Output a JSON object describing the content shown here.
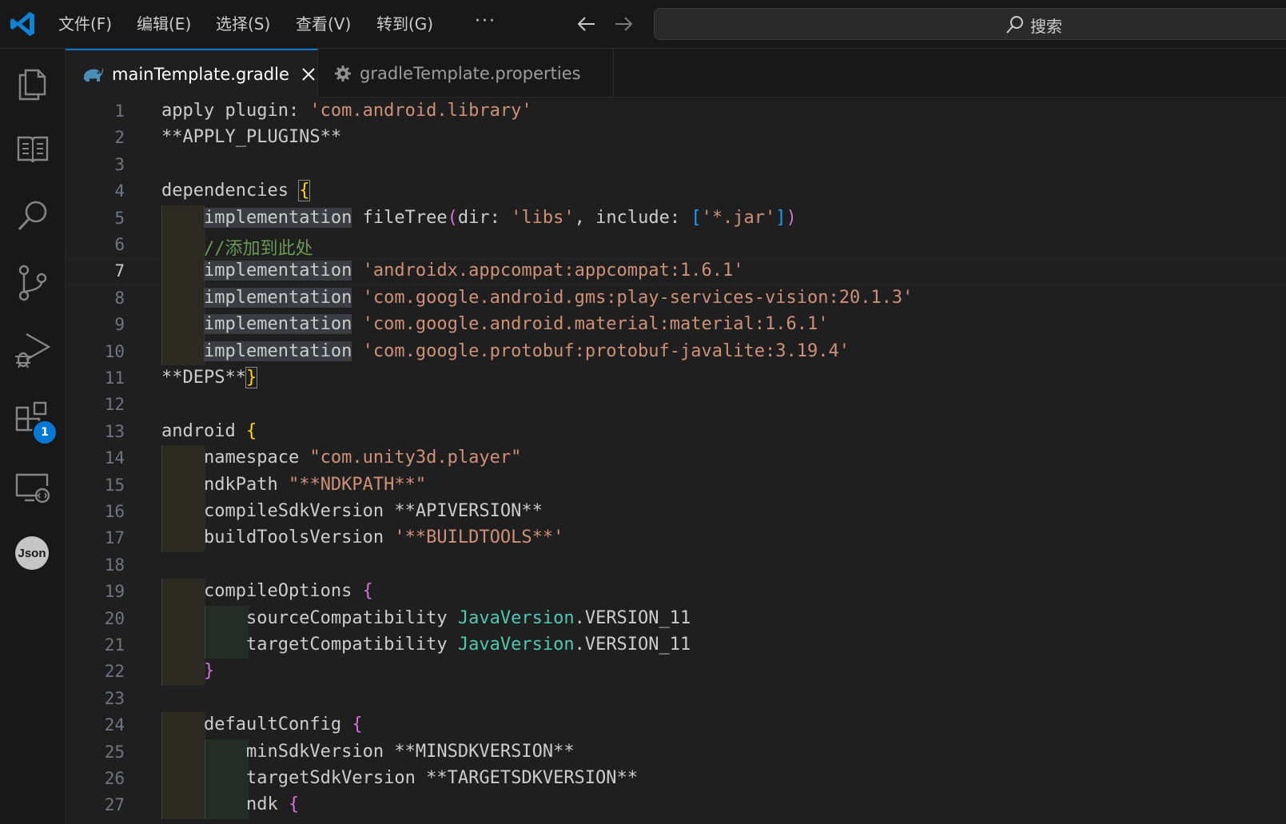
{
  "titlebar": {
    "menu": [
      "文件(F)",
      "编辑(E)",
      "选择(S)",
      "查看(V)",
      "转到(G)"
    ],
    "more": "···",
    "search_placeholder": "搜索"
  },
  "activitybar": {
    "items": [
      "files-icon",
      "book-icon",
      "search-icon",
      "source-control-icon",
      "run-debug-icon",
      "extensions-icon",
      "remote-explorer-icon",
      "json-icon"
    ],
    "extensions_badge": "1",
    "json_label": "Json"
  },
  "tabs": [
    {
      "label": "mainTemplate.gradle",
      "active": true,
      "icon": "gradle-elephant-icon"
    },
    {
      "label": "gradleTemplate.properties",
      "active": false,
      "icon": "gear-icon"
    }
  ],
  "editor": {
    "current_line": 7,
    "lines": [
      {
        "n": "1",
        "text": "apply plugin: 'com.android.library'"
      },
      {
        "n": "2",
        "text": "**APPLY_PLUGINS**"
      },
      {
        "n": "3",
        "text": ""
      },
      {
        "n": "4",
        "text": "dependencies {"
      },
      {
        "n": "5",
        "text": "    implementation fileTree(dir: 'libs', include: ['*.jar'])"
      },
      {
        "n": "6",
        "text": "    //添加到此处"
      },
      {
        "n": "7",
        "text": "    implementation 'androidx.appcompat:appcompat:1.6.1'"
      },
      {
        "n": "8",
        "text": "    implementation 'com.google.android.gms:play-services-vision:20.1.3'"
      },
      {
        "n": "9",
        "text": "    implementation 'com.google.android.material:material:1.6.1'"
      },
      {
        "n": "10",
        "text": "    implementation 'com.google.protobuf:protobuf-javalite:3.19.4'"
      },
      {
        "n": "11",
        "text": "**DEPS**}"
      },
      {
        "n": "12",
        "text": ""
      },
      {
        "n": "13",
        "text": "android {"
      },
      {
        "n": "14",
        "text": "    namespace \"com.unity3d.player\""
      },
      {
        "n": "15",
        "text": "    ndkPath \"**NDKPATH**\""
      },
      {
        "n": "16",
        "text": "    compileSdkVersion **APIVERSION**"
      },
      {
        "n": "17",
        "text": "    buildToolsVersion '**BUILDTOOLS**'"
      },
      {
        "n": "18",
        "text": ""
      },
      {
        "n": "19",
        "text": "    compileOptions {"
      },
      {
        "n": "20",
        "text": "        sourceCompatibility JavaVersion.VERSION_11"
      },
      {
        "n": "21",
        "text": "        targetCompatibility JavaVersion.VERSION_11"
      },
      {
        "n": "22",
        "text": "    }"
      },
      {
        "n": "23",
        "text": ""
      },
      {
        "n": "24",
        "text": "    defaultConfig {"
      },
      {
        "n": "25",
        "text": "        minSdkVersion **MINSDKVERSION**"
      },
      {
        "n": "26",
        "text": "        targetSdkVersion **TARGETSDKVERSION**"
      },
      {
        "n": "27",
        "text": "        ndk {"
      }
    ]
  },
  "colors": {
    "accent": "#0078d4",
    "string": "#ce9178",
    "comment": "#6a9955",
    "type": "#4ec9b0",
    "bracket_level1": "#ffd700",
    "bracket_level2": "#da70d6",
    "bracket_level3": "#179fff"
  }
}
